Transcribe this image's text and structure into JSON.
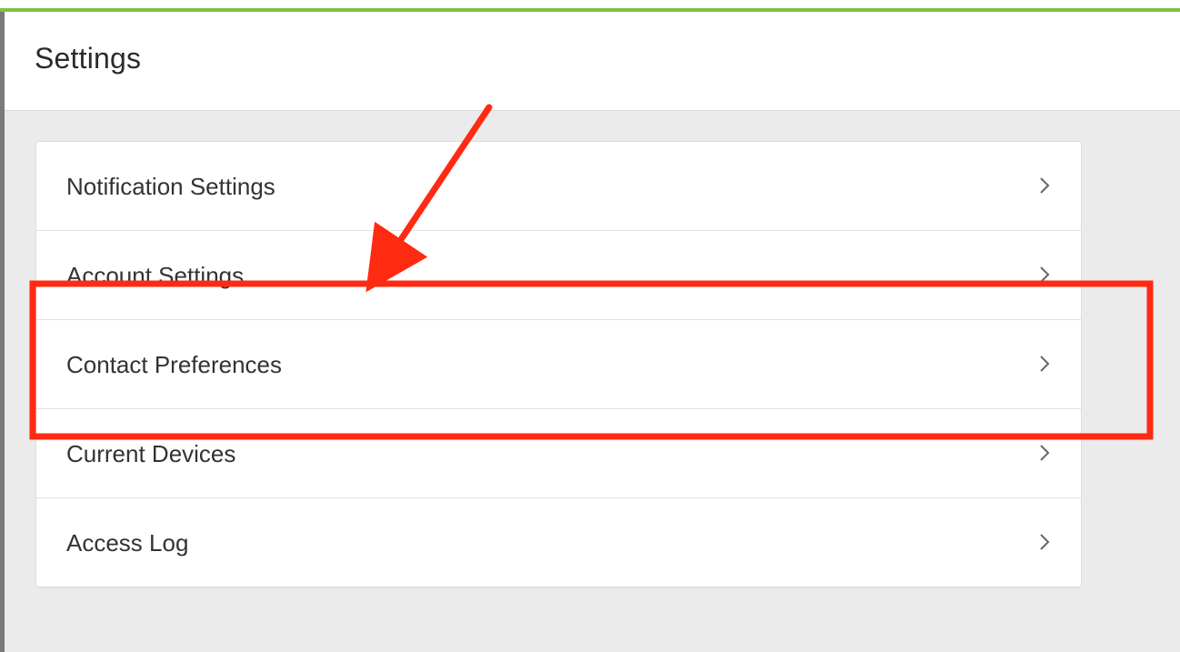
{
  "header": {
    "title": "Settings"
  },
  "settings": {
    "items": [
      {
        "label": "Notification Settings",
        "icon": "chevron-right-icon"
      },
      {
        "label": "Account Settings",
        "icon": "chevron-right-icon"
      },
      {
        "label": "Contact Preferences",
        "icon": "chevron-right-icon"
      },
      {
        "label": "Current Devices",
        "icon": "chevron-right-icon"
      },
      {
        "label": "Access Log",
        "icon": "chevron-right-icon"
      }
    ]
  },
  "annotation": {
    "highlighted_item": "Contact Preferences",
    "color": "#ff2a12"
  },
  "colors": {
    "accent": "#7fc241",
    "content_background": "#ebebeb",
    "card_background": "#ffffff",
    "text": "#333333"
  }
}
